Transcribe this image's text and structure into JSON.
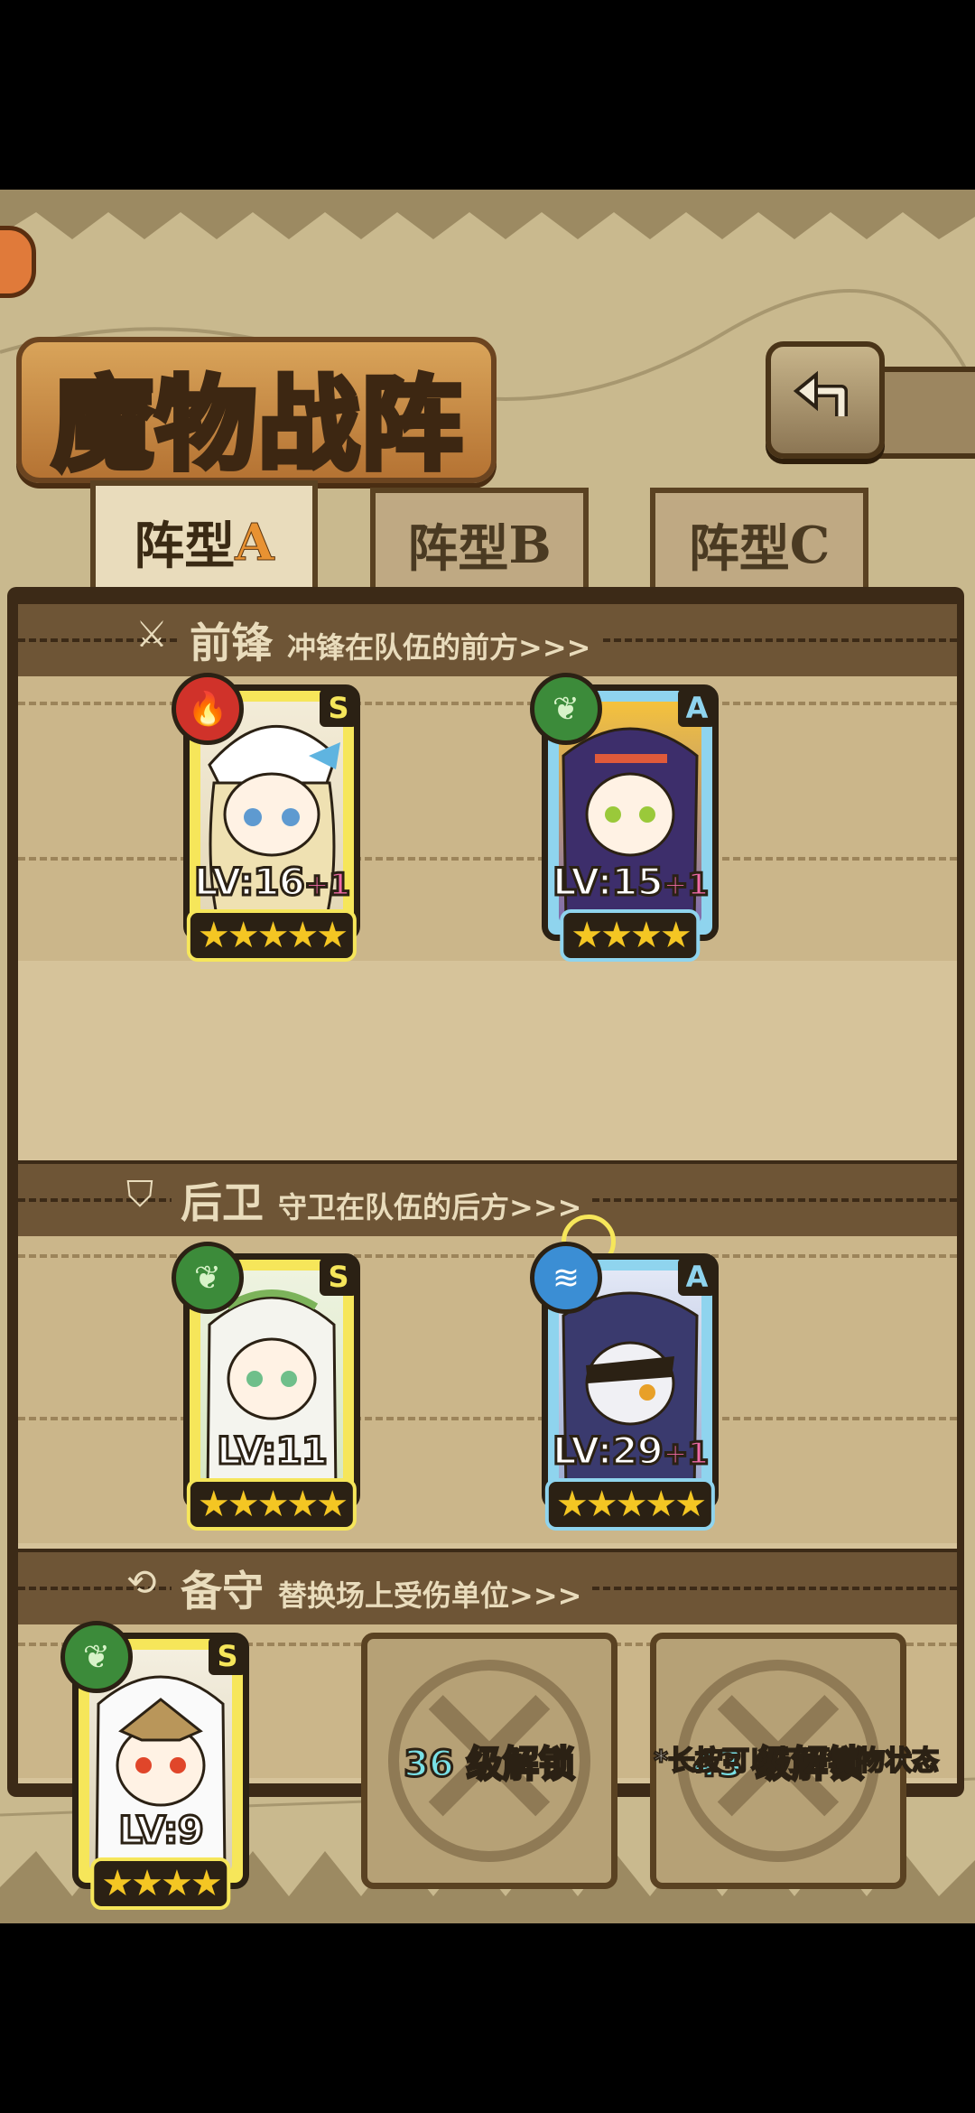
{
  "title": "魔物战阵",
  "tabs": [
    {
      "label": "阵型",
      "letter": "A",
      "active": true
    },
    {
      "label": "阵型",
      "letter": "B",
      "active": false
    },
    {
      "label": "阵型",
      "letter": "C",
      "active": false
    }
  ],
  "sections": {
    "front": {
      "title": "前锋",
      "desc": "冲锋在队伍的前方>>>",
      "icon": "sword-icon"
    },
    "rear": {
      "title": "后卫",
      "desc": "守卫在队伍的后方>>>",
      "icon": "shield-icon"
    },
    "reserve": {
      "title": "备守",
      "desc": "替换场上受伤单位>>>",
      "icon": "swap-icon"
    }
  },
  "front_cards": [
    {
      "rank": "S",
      "element": "fire-icon",
      "level": "LV:16",
      "bonus": "+1",
      "stars": "★★★★★"
    },
    {
      "rank": "A",
      "element": "leaf-icon",
      "level": "LV:15",
      "bonus": "+1",
      "stars": "★★★★"
    }
  ],
  "rear_cards": [
    {
      "rank": "S",
      "element": "leaf-icon",
      "level": "LV:11",
      "bonus": "",
      "stars": "★★★★★"
    },
    {
      "rank": "A",
      "element": "water-icon",
      "level": "LV:29",
      "bonus": "+1",
      "stars": "★★★★★"
    }
  ],
  "reserve_card": {
    "rank": "S",
    "element": "leaf-icon",
    "level": "LV:9",
    "bonus": "",
    "stars": "★★★★"
  },
  "locked_slots": [
    {
      "level": "36",
      "text": " 级解锁"
    },
    {
      "level": "43",
      "text": " 级解锁"
    }
  ],
  "hint": "*长按可以打开魔物状态",
  "colors": {
    "rank_S": "#f6e65a",
    "rank_A": "#8fd4ee",
    "bonus": "#f06aa6",
    "unlock_num": "#78e0e6"
  }
}
